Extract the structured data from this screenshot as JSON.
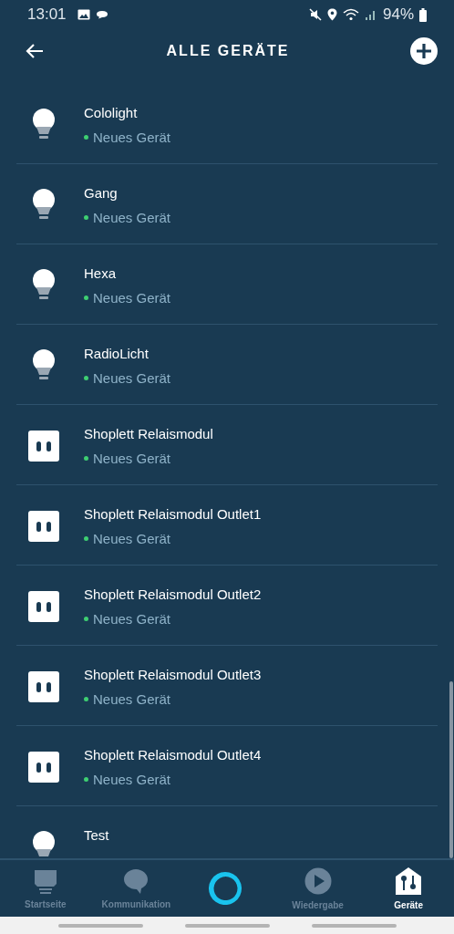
{
  "status_bar": {
    "time": "13:01",
    "battery": "94%"
  },
  "header": {
    "title": "ALLE GERÄTE"
  },
  "devices": [
    {
      "name": "Cololight",
      "kind": "bulb",
      "status": "Neues Gerät"
    },
    {
      "name": "Gang",
      "kind": "bulb",
      "status": "Neues Gerät"
    },
    {
      "name": "Hexa",
      "kind": "bulb",
      "status": "Neues Gerät"
    },
    {
      "name": "RadioLicht",
      "kind": "bulb",
      "status": "Neues Gerät"
    },
    {
      "name": "Shoplett Relaismodul",
      "kind": "plug",
      "status": "Neues Gerät"
    },
    {
      "name": "Shoplett Relaismodul Outlet1",
      "kind": "plug",
      "status": "Neues Gerät"
    },
    {
      "name": "Shoplett Relaismodul Outlet2",
      "kind": "plug",
      "status": "Neues Gerät"
    },
    {
      "name": "Shoplett Relaismodul Outlet3",
      "kind": "plug",
      "status": "Neues Gerät"
    },
    {
      "name": "Shoplett Relaismodul Outlet4",
      "kind": "plug",
      "status": "Neues Gerät"
    },
    {
      "name": "Test",
      "kind": "bulb"
    }
  ],
  "nav": [
    {
      "label": "Startseite",
      "kind": "home",
      "selected": false
    },
    {
      "label": "Kommunikation",
      "kind": "chat",
      "selected": false
    },
    {
      "kind": "alexa",
      "selected": false
    },
    {
      "label": "Wiedergabe",
      "kind": "play",
      "selected": false
    },
    {
      "label": "Geräte",
      "kind": "devices",
      "selected": true
    }
  ]
}
